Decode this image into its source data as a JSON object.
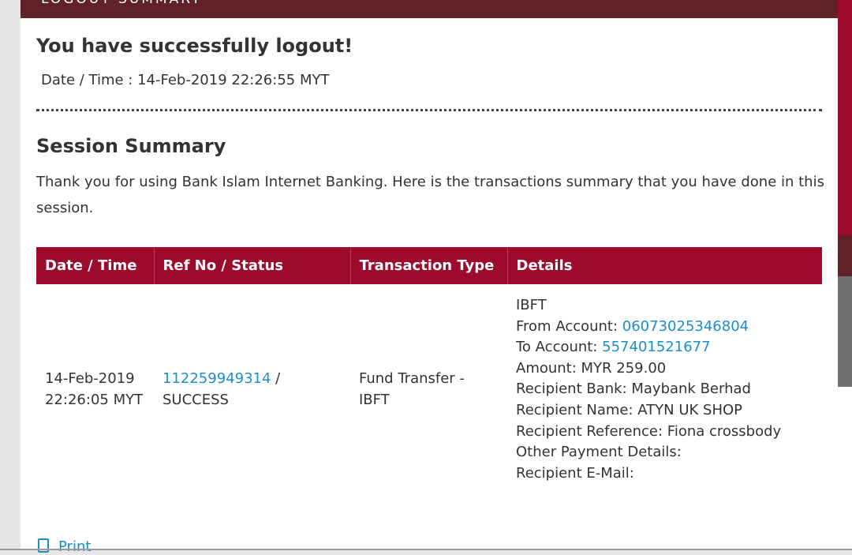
{
  "header": {
    "title": "LOGOUT SUMMARY"
  },
  "logout": {
    "title": "You have successfully logout!",
    "datetime": "Date / Time : 14-Feb-2019 22:26:55 MYT"
  },
  "session": {
    "title": "Session Summary",
    "intro": "Thank you for using Bank Islam Internet Banking. Here is the transactions summary that you have done in this session."
  },
  "table": {
    "headers": [
      "Date / Time",
      "Ref No / Status",
      "Transaction Type",
      "Details"
    ],
    "rows": [
      {
        "date": "14-Feb-2019",
        "time": "22:26:05 MYT",
        "ref_no": "112259949314",
        "ref_sep": " /",
        "status": "SUCCESS",
        "type_line1": "Fund Transfer -",
        "type_line2": "IBFT",
        "details": {
          "service": "IBFT",
          "from_label": "From Account: ",
          "from_account": "06073025346804",
          "to_label": "To Account: ",
          "to_account": "557401521677",
          "amount": "Amount: MYR 259.00",
          "bank": "Recipient Bank: Maybank Berhad",
          "name": "Recipient Name: ATYN UK SHOP",
          "reference": "Recipient Reference: Fiona crossbody",
          "other": "Other Payment Details:",
          "email": "Recipient E-Mail:"
        }
      }
    ]
  },
  "actions": {
    "print": "Print"
  },
  "colors": {
    "header_bg": "#5e2228",
    "table_header_bg": "#9c0a2c",
    "link": "#1a8fc9",
    "text": "#333333"
  }
}
